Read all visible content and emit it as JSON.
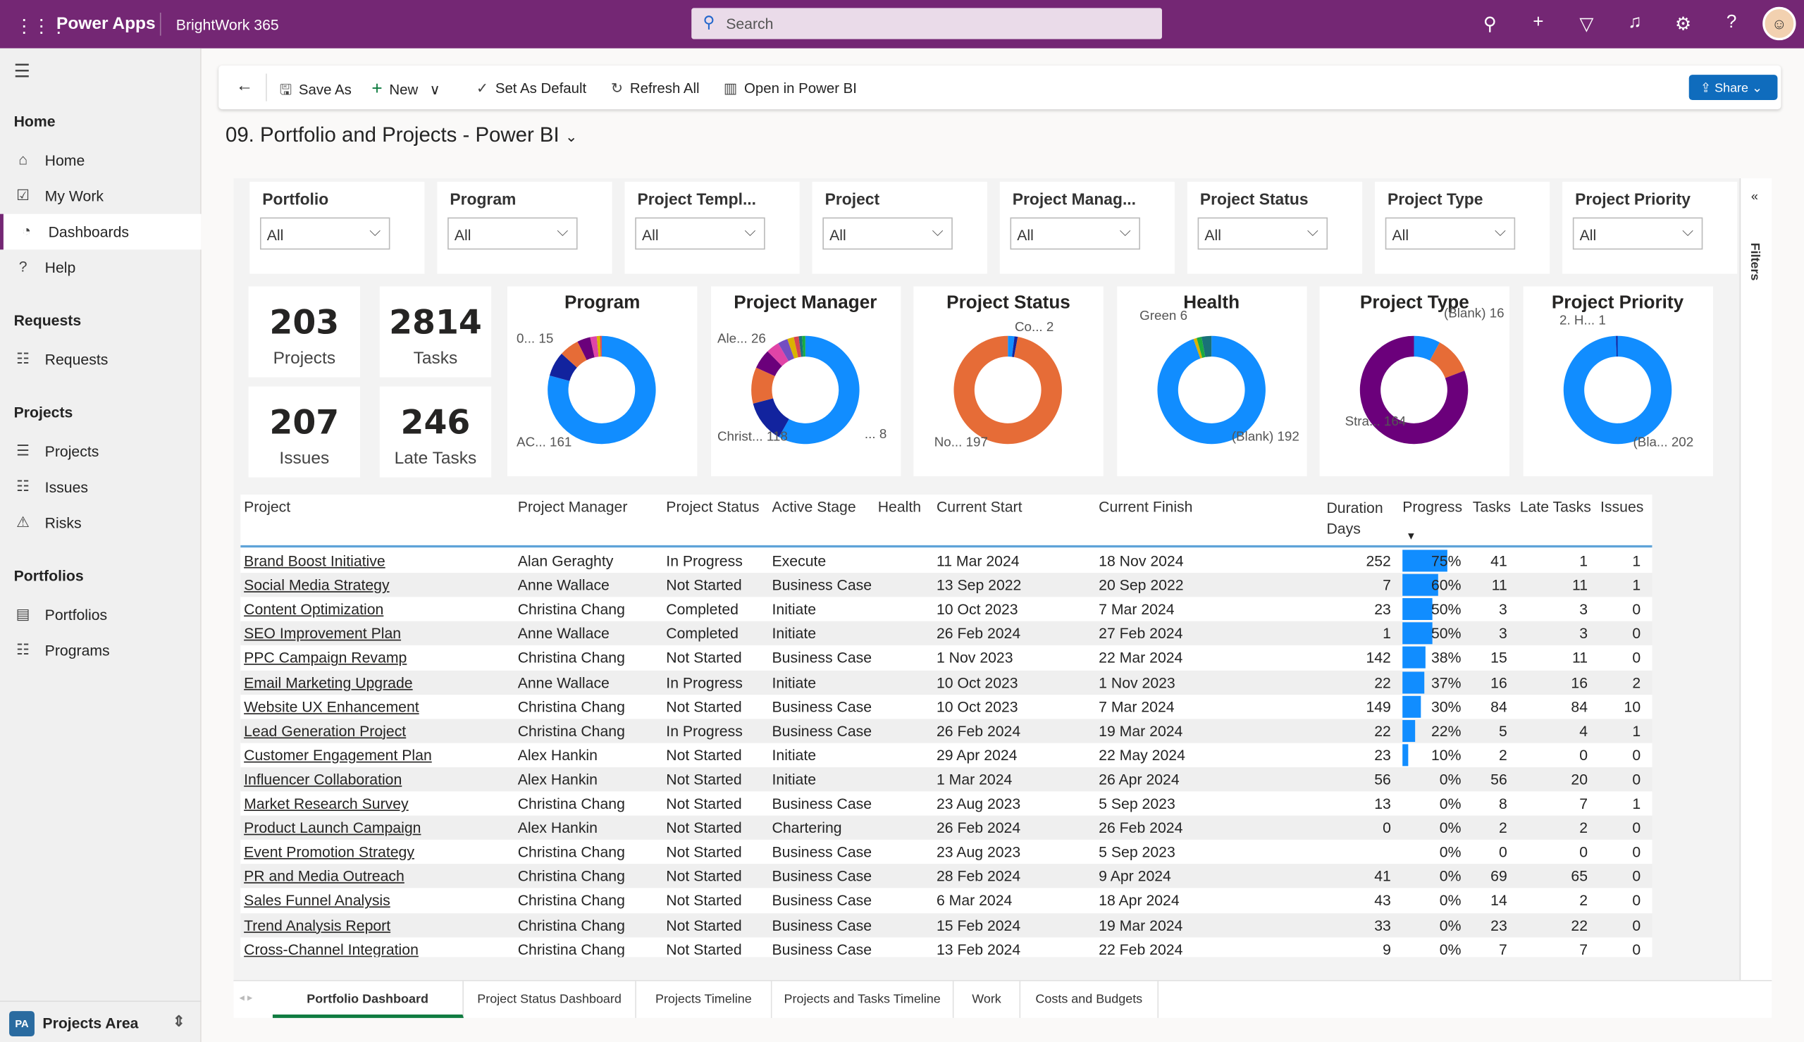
{
  "topbar": {
    "app": "Power Apps",
    "environment": "BrightWork 365",
    "search_placeholder": "Search",
    "avatar": "☺"
  },
  "sidebar": {
    "sections": [
      {
        "title": "Home",
        "items": [
          {
            "label": "Home",
            "icon": "⌂"
          },
          {
            "label": "My Work",
            "icon": "☑"
          },
          {
            "label": "Dashboards",
            "icon": "◔"
          },
          {
            "label": "Help",
            "icon": "?"
          }
        ]
      },
      {
        "title": "Requests",
        "items": [
          {
            "label": "Requests",
            "icon": "☷"
          }
        ]
      },
      {
        "title": "Projects",
        "items": [
          {
            "label": "Projects",
            "icon": "☰"
          },
          {
            "label": "Issues",
            "icon": "☷"
          },
          {
            "label": "Risks",
            "icon": "⚠"
          }
        ]
      },
      {
        "title": "Portfolios",
        "items": [
          {
            "label": "Portfolios",
            "icon": "▤"
          },
          {
            "label": "Programs",
            "icon": "☷"
          }
        ]
      }
    ],
    "selected": "Dashboards",
    "area_badge": "PA",
    "area": "Projects Area"
  },
  "commandbar": {
    "save_as": "Save As",
    "new": "New",
    "set_default": "Set As Default",
    "refresh": "Refresh All",
    "open_pbi": "Open in Power BI",
    "share": "Share"
  },
  "page_title": "09. Portfolio and Projects - Power BI",
  "slicers": [
    {
      "label": "Portfolio",
      "value": "All"
    },
    {
      "label": "Program",
      "value": "All"
    },
    {
      "label": "Project Templ...",
      "value": "All"
    },
    {
      "label": "Project",
      "value": "All"
    },
    {
      "label": "Project Manag...",
      "value": "All"
    },
    {
      "label": "Project Status",
      "value": "All"
    },
    {
      "label": "Project Type",
      "value": "All"
    },
    {
      "label": "Project Priority",
      "value": "All"
    }
  ],
  "kpis": [
    {
      "value": "203",
      "label": "Projects"
    },
    {
      "value": "2814",
      "label": "Tasks"
    },
    {
      "value": "207",
      "label": "Issues"
    },
    {
      "value": "246",
      "label": "Late Tasks"
    }
  ],
  "chart_data": [
    {
      "type": "pie",
      "title": "Program",
      "values": [
        161,
        15,
        12,
        8,
        4,
        2,
        1
      ],
      "colors": [
        "#118DFF",
        "#12239E",
        "#E66C37",
        "#6B007B",
        "#E044A7",
        "#D9B300",
        "#D64550"
      ],
      "labels": [
        {
          "text": "AC...",
          "value": "161"
        },
        {
          "text": "0...",
          "value": "15"
        }
      ]
    },
    {
      "type": "pie",
      "title": "Project Manager",
      "values": [
        118,
        26,
        22,
        12,
        8,
        6,
        4,
        3,
        2,
        2
      ],
      "colors": [
        "#118DFF",
        "#12239E",
        "#E66C37",
        "#6B007B",
        "#E044A7",
        "#744EC2",
        "#D9B300",
        "#D64550",
        "#197278",
        "#1AAB40"
      ],
      "labels": [
        {
          "text": "Christ...",
          "value": "118"
        },
        {
          "text": "Ale...",
          "value": "26"
        },
        {
          "text": "...",
          "value": "8"
        }
      ]
    },
    {
      "type": "pie",
      "title": "Project Status",
      "values": [
        4,
        2,
        197
      ],
      "colors": [
        "#118DFF",
        "#12239E",
        "#E66C37"
      ],
      "labels": [
        {
          "text": "Co...",
          "value": "2"
        },
        {
          "text": "No...",
          "value": "197"
        }
      ]
    },
    {
      "type": "pie",
      "title": "Health",
      "values": [
        192,
        2,
        3,
        6
      ],
      "colors": [
        "#118DFF",
        "#D9B300",
        "#1AAB40",
        "#197278"
      ],
      "labels": [
        {
          "text": "Green",
          "value": "6"
        },
        {
          "text": "(Blank)",
          "value": "192"
        }
      ]
    },
    {
      "type": "pie",
      "title": "Project Type",
      "values": [
        16,
        23,
        164
      ],
      "colors": [
        "#118DFF",
        "#E66C37",
        "#6B007B"
      ],
      "labels": [
        {
          "text": "(Blank)",
          "value": "16"
        },
        {
          "text": "Stra...",
          "value": "164"
        }
      ]
    },
    {
      "type": "pie",
      "title": "Project Priority",
      "values": [
        202,
        1
      ],
      "colors": [
        "#118DFF",
        "#12239E"
      ],
      "labels": [
        {
          "text": "2. H...",
          "value": "1"
        },
        {
          "text": "(Bla...",
          "value": "202"
        }
      ]
    }
  ],
  "table": {
    "headers": [
      "Project",
      "Project Manager",
      "Project Status",
      "Active Stage",
      "Health",
      "Current Start",
      "Current Finish",
      "Duration Days",
      "Progress",
      "Tasks",
      "Late Tasks",
      "Issues"
    ],
    "rows": [
      [
        "Brand Boost Initiative",
        "Alan Geraghty",
        "In Progress",
        "Execute",
        "",
        "11 Mar 2024",
        "18 Nov 2024",
        "252",
        "75%",
        "41",
        "1",
        "1"
      ],
      [
        "Social Media Strategy",
        "Anne Wallace",
        "Not Started",
        "Business Case",
        "",
        "13 Sep 2022",
        "20 Sep 2022",
        "7",
        "60%",
        "11",
        "11",
        "1"
      ],
      [
        "Content Optimization",
        "Christina Chang",
        "Completed",
        "Initiate",
        "",
        "10 Oct 2023",
        "7 Mar 2024",
        "23",
        "50%",
        "3",
        "3",
        "0"
      ],
      [
        "SEO Improvement Plan",
        "Anne Wallace",
        "Completed",
        "Initiate",
        "",
        "26 Feb 2024",
        "27 Feb 2024",
        "1",
        "50%",
        "3",
        "3",
        "0"
      ],
      [
        "PPC Campaign Revamp",
        "Christina Chang",
        "Not Started",
        "Business Case",
        "",
        "1 Nov 2023",
        "22 Mar 2024",
        "142",
        "38%",
        "15",
        "11",
        "0"
      ],
      [
        "Email Marketing Upgrade",
        "Anne Wallace",
        "In Progress",
        "Initiate",
        "",
        "10 Oct 2023",
        "1 Nov 2023",
        "22",
        "37%",
        "16",
        "16",
        "2"
      ],
      [
        "Website UX Enhancement",
        "Christina Chang",
        "Not Started",
        "Business Case",
        "",
        "10 Oct 2023",
        "7 Mar 2024",
        "149",
        "30%",
        "84",
        "84",
        "10"
      ],
      [
        "Lead Generation Project",
        "Christina Chang",
        "In Progress",
        "Business Case",
        "",
        "26 Feb 2024",
        "19 Mar 2024",
        "22",
        "22%",
        "5",
        "4",
        "1"
      ],
      [
        "Customer Engagement Plan",
        "Alex Hankin",
        "Not Started",
        "Initiate",
        "",
        "29 Apr 2024",
        "22 May 2024",
        "23",
        "10%",
        "2",
        "0",
        "0"
      ],
      [
        "Influencer Collaboration",
        "Alex Hankin",
        "Not Started",
        "Initiate",
        "",
        "1 Mar 2024",
        "26 Apr 2024",
        "56",
        "0%",
        "56",
        "20",
        "0"
      ],
      [
        "Market Research Survey",
        "Christina Chang",
        "Not Started",
        "Business Case",
        "",
        "23 Aug 2023",
        "5 Sep 2023",
        "13",
        "0%",
        "8",
        "7",
        "1"
      ],
      [
        "Product Launch Campaign",
        "Alex Hankin",
        "Not Started",
        "Chartering",
        "",
        "26 Feb 2024",
        "26 Feb 2024",
        "0",
        "0%",
        "2",
        "2",
        "0"
      ],
      [
        "Event Promotion Strategy",
        "Christina Chang",
        "Not Started",
        "Business Case",
        "",
        "23 Aug 2023",
        "5 Sep 2023",
        "",
        "0%",
        "0",
        "0",
        "0"
      ],
      [
        "PR and Media Outreach",
        "Christina Chang",
        "Not Started",
        "Business Case",
        "",
        "28 Feb 2024",
        "9 Apr 2024",
        "41",
        "0%",
        "69",
        "65",
        "0"
      ],
      [
        "Sales Funnel Analysis",
        "Christina Chang",
        "Not Started",
        "Business Case",
        "",
        "6 Mar 2024",
        "18 Apr 2024",
        "43",
        "0%",
        "14",
        "2",
        "0"
      ],
      [
        "Trend Analysis Report",
        "Christina Chang",
        "Not Started",
        "Business Case",
        "",
        "15 Feb 2024",
        "19 Mar 2024",
        "33",
        "0%",
        "23",
        "22",
        "0"
      ],
      [
        "Cross-Channel Integration",
        "Christina Chang",
        "Not Started",
        "Business Case",
        "",
        "13 Feb 2024",
        "22 Feb 2024",
        "9",
        "0%",
        "7",
        "7",
        "0"
      ]
    ]
  },
  "tabs": [
    {
      "label": "Portfolio Dashboard",
      "selected": true
    },
    {
      "label": "Project Status Dashboard"
    },
    {
      "label": "Projects Timeline"
    },
    {
      "label": "Projects and Tasks Timeline"
    },
    {
      "label": "Work"
    },
    {
      "label": "Costs and Budgets"
    }
  ],
  "filters_label": "Filters"
}
